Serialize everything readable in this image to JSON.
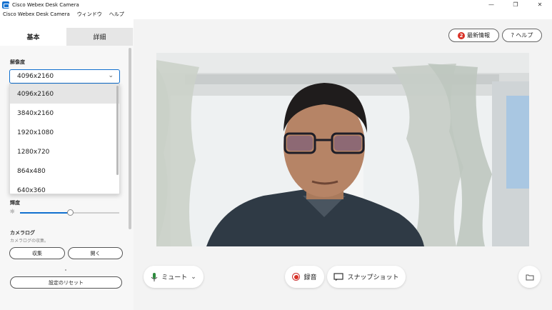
{
  "window": {
    "title": "Cisco Webex Desk Camera",
    "minimize_glyph": "—",
    "restore_glyph": "❐",
    "close_glyph": "✕"
  },
  "menu": {
    "items": [
      "Cisco Webex Desk Camera",
      "ウィンドウ",
      "ヘルプ"
    ]
  },
  "tabs": {
    "basic": "基本",
    "detail": "詳細"
  },
  "resolution": {
    "label": "解像度",
    "selected": "4096x2160",
    "options": [
      "4096x2160",
      "3840x2160",
      "1920x1080",
      "1280x720",
      "864x480",
      "640x360"
    ]
  },
  "brightness": {
    "label": "輝度",
    "level": 0.5
  },
  "camera_log": {
    "label": "カメラログ",
    "description": "カメラログの収集。",
    "collect_label": "収集",
    "open_label": "開く"
  },
  "reset_label": "設定のリセット",
  "header": {
    "news_badge": "2",
    "news_label": "最新情報",
    "help_label": "? ヘルプ"
  },
  "controls": {
    "mute_label": "ミュート",
    "record_label": "録音",
    "snapshot_label": "スナップショット"
  },
  "colors": {
    "accent": "#1170cf",
    "badge": "#d93025",
    "mic": "#2e8b3e"
  }
}
